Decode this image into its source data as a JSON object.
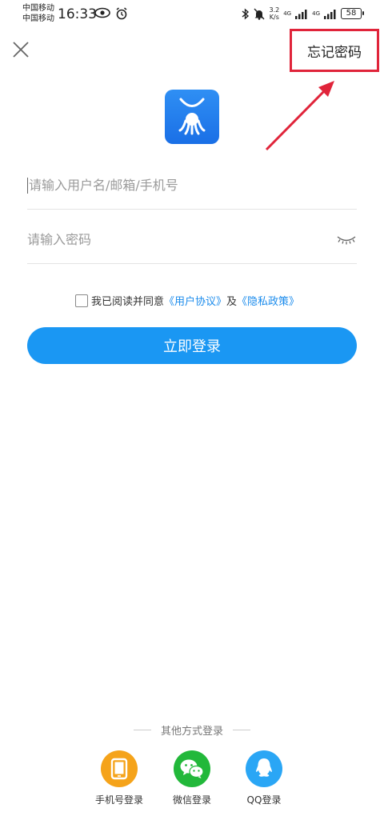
{
  "status_bar": {
    "carrier_1": "中国移动",
    "carrier_2": "中国移动",
    "time": "16:33",
    "speed_value": "3.2",
    "speed_unit": "K/s",
    "net_1": "4G",
    "net_2": "4G",
    "battery": "58"
  },
  "header": {
    "forgot_password": "忘记密码"
  },
  "form": {
    "username_placeholder": "请输入用户名/邮箱/手机号",
    "password_placeholder": "请输入密码"
  },
  "agreement": {
    "prefix": "我已阅读并同意",
    "user_agreement": "《用户协议》",
    "connector": "及",
    "privacy_policy": "《隐私政策》"
  },
  "login_button": "立即登录",
  "other_login": {
    "title": "其他方式登录",
    "methods": [
      {
        "label": "手机号登录",
        "icon": "phone-icon",
        "color": "#f5a31a"
      },
      {
        "label": "微信登录",
        "icon": "wechat-icon",
        "color": "#22b83a"
      },
      {
        "label": "QQ登录",
        "icon": "qq-icon",
        "color": "#2aa6f5"
      }
    ]
  },
  "colors": {
    "primary": "#1a97f3",
    "link": "#1a8bec",
    "annotation": "#e0243a"
  }
}
